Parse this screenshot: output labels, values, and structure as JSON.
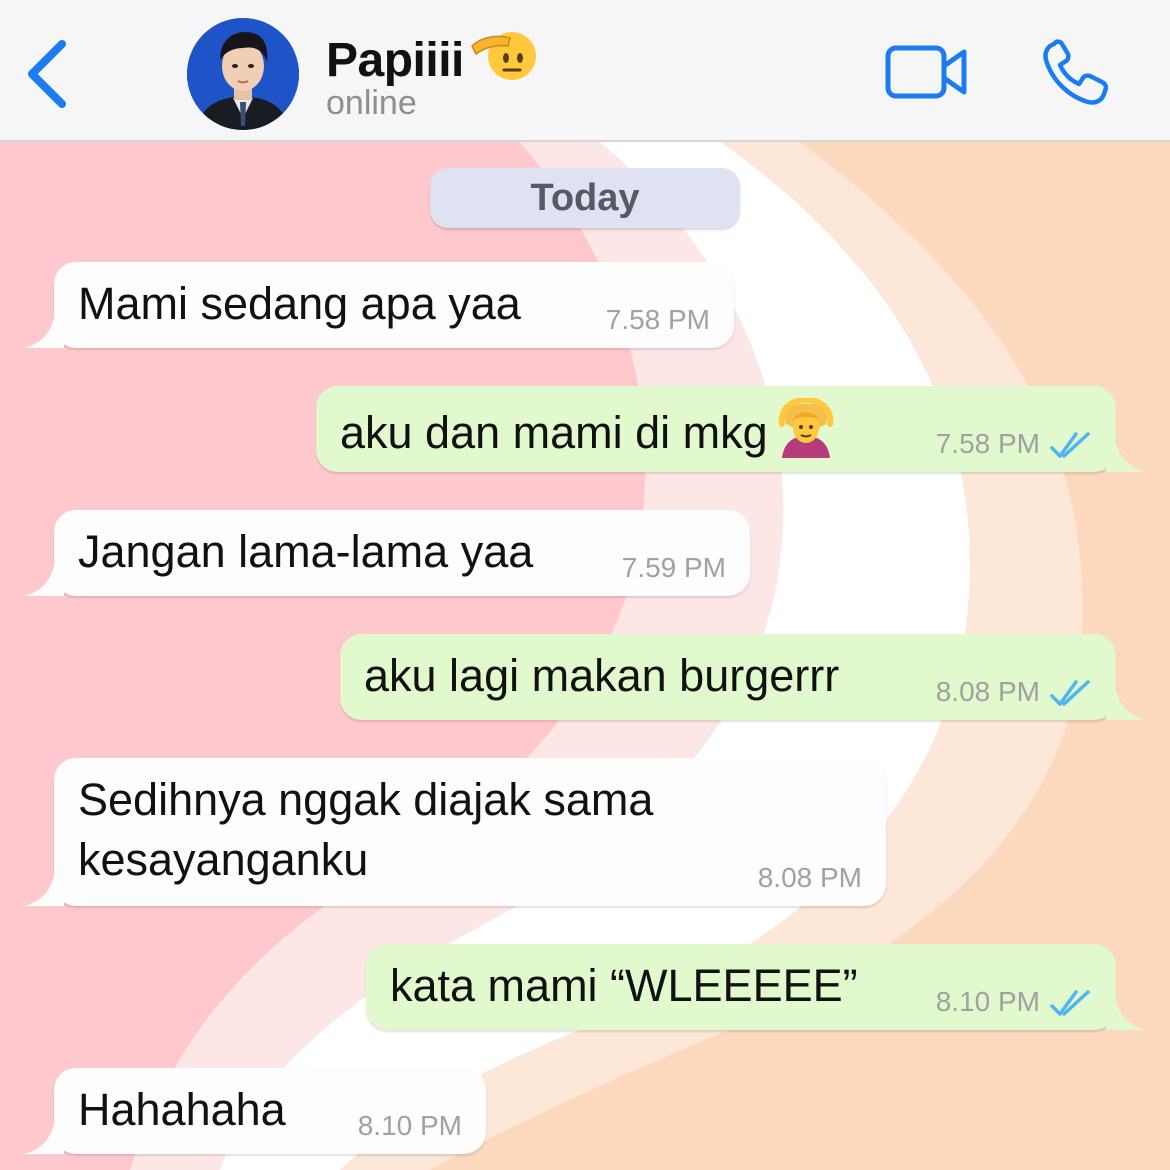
{
  "header": {
    "back_icon": "chevron-left-icon",
    "contact_name": "Papiiii",
    "contact_emoji": "saluting-face-emoji",
    "status": "online",
    "video_icon": "video-camera-icon",
    "call_icon": "phone-icon",
    "accent_color": "#1a7cf5"
  },
  "chat": {
    "date_label": "Today",
    "messages": [
      {
        "direction": "incoming",
        "text": "Mami sedang apa yaa",
        "time": "7.58 PM"
      },
      {
        "direction": "outgoing",
        "text": "aku dan mami di mkg",
        "emoji": "person-gesturing-ok-emoji",
        "time": "7.58 PM",
        "status": "read"
      },
      {
        "direction": "incoming",
        "text": "Jangan lama-lama yaa",
        "time": "7.59 PM"
      },
      {
        "direction": "outgoing",
        "text": "aku lagi makan burgerrr",
        "time": "8.08 PM",
        "status": "read"
      },
      {
        "direction": "incoming",
        "text": "Sedihnya nggak diajak sama kesayanganku",
        "time": "8.08 PM"
      },
      {
        "direction": "outgoing",
        "text": "kata mami “WLEEEEE”",
        "time": "8.10 PM",
        "status": "read"
      },
      {
        "direction": "incoming",
        "text": "Hahahaha",
        "time": "8.10 PM"
      }
    ],
    "colors": {
      "incoming_bubble": "#fdfdfd",
      "outgoing_bubble": "#e2f9ce",
      "read_ticks": "#4fb5f0"
    }
  }
}
